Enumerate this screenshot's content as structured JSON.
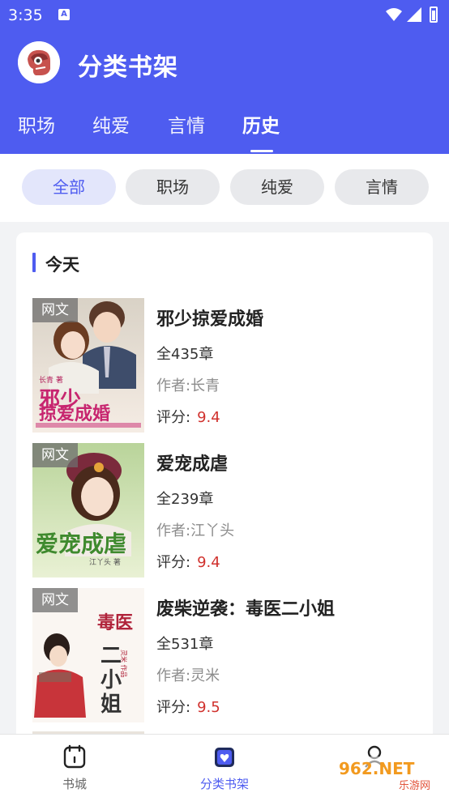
{
  "status_bar": {
    "time": "3:35",
    "notification_icon": "a-icon"
  },
  "header": {
    "title": "分类书架",
    "tabs": [
      {
        "label": "职场"
      },
      {
        "label": "纯爱"
      },
      {
        "label": "言情"
      },
      {
        "label": "历史",
        "active": true
      }
    ]
  },
  "filters": [
    {
      "label": "全部",
      "active": true
    },
    {
      "label": "职场"
    },
    {
      "label": "纯爱"
    },
    {
      "label": "言情"
    }
  ],
  "section": {
    "title": "今天"
  },
  "books": [
    {
      "tag": "网文",
      "title": "邪少掠爱成婚",
      "chapters": "全435章",
      "author": "作者:长青",
      "rating_label": "评分:",
      "rating": "9.4",
      "cover_text": "邪少掠爱成婚",
      "cover_subtext": "长青 著"
    },
    {
      "tag": "网文",
      "title": "爱宠成虐",
      "chapters": "全239章",
      "author": "作者:江丫头",
      "rating_label": "评分:",
      "rating": "9.4",
      "cover_text": "爱宠成虐",
      "cover_subtext": "江丫头 著"
    },
    {
      "tag": "网文",
      "title": "废柴逆袭：毒医二小姐",
      "chapters": "全531章",
      "author": "作者:灵米",
      "rating_label": "评分:",
      "rating": "9.5",
      "cover_text": "毒医二小姐",
      "cover_subtext": "灵米 作品"
    }
  ],
  "bottom_nav": [
    {
      "label": "书城",
      "icon": "bookstore-icon"
    },
    {
      "label": "分类书架",
      "icon": "bookshelf-icon",
      "active": true
    },
    {
      "label": "",
      "icon": "profile-icon"
    }
  ],
  "watermark": {
    "text": "962.NET",
    "subtext": "乐游网"
  },
  "colors": {
    "primary": "#4e5cf0",
    "rating": "#d0312d",
    "chip_active_bg": "#e3e6fb"
  }
}
